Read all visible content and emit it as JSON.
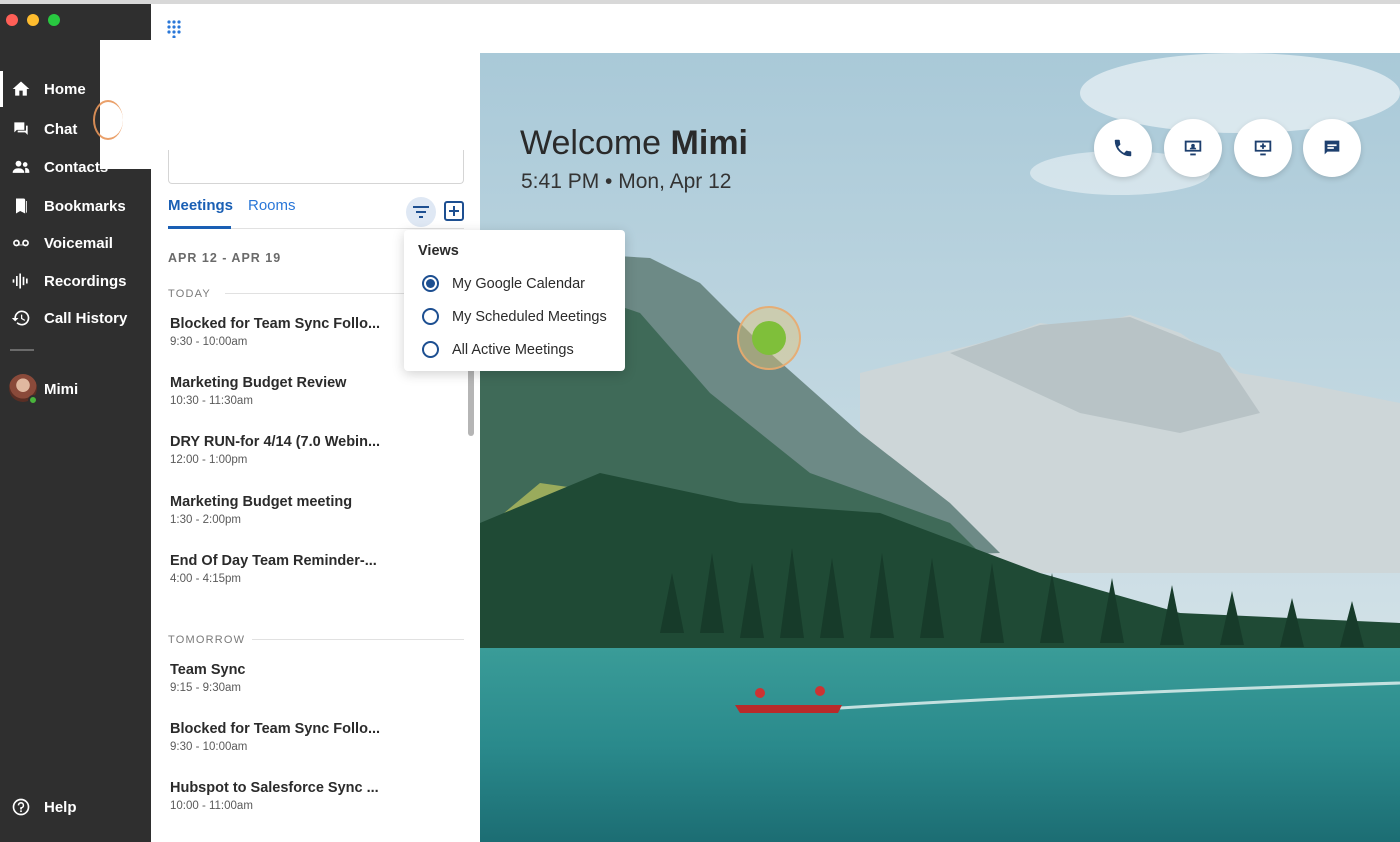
{
  "window": {
    "traffic_colors": [
      "#ff5f57",
      "#febc2e",
      "#28c840"
    ]
  },
  "sidebar": {
    "items": [
      {
        "label": "Home",
        "icon": "home-icon"
      },
      {
        "label": "Chat",
        "icon": "chat-icon"
      },
      {
        "label": "Contacts",
        "icon": "contacts-icon"
      },
      {
        "label": "Bookmarks",
        "icon": "bookmark-icon"
      },
      {
        "label": "Voicemail",
        "icon": "voicemail-icon"
      },
      {
        "label": "Recordings",
        "icon": "recordings-icon"
      },
      {
        "label": "Call History",
        "icon": "history-icon"
      }
    ],
    "user": {
      "name": "Mimi",
      "status_color": "#49b43c"
    },
    "help": "Help"
  },
  "meetings_panel": {
    "tabs": [
      "Meetings",
      "Rooms"
    ],
    "date_range": "APR 12 - APR 19",
    "today_label": "TODAY",
    "tomorrow_label": "TOMORROW",
    "today": [
      {
        "title": "Blocked for Team Sync Follo...",
        "time": "9:30 - 10:00am"
      },
      {
        "title": "Marketing Budget Review",
        "time": "10:30 - 11:30am"
      },
      {
        "title": "DRY RUN-for 4/14 (7.0 Webin...",
        "time": "12:00 - 1:00pm"
      },
      {
        "title": "Marketing Budget meeting",
        "time": "1:30 - 2:00pm"
      },
      {
        "title": "End Of Day Team Reminder-...",
        "time": "4:00 - 4:15pm"
      }
    ],
    "tomorrow": [
      {
        "title": "Team Sync",
        "time": "9:15 - 9:30am"
      },
      {
        "title": "Blocked for Team Sync Follo...",
        "time": "9:30 - 10:00am"
      },
      {
        "title": "Hubspot to Salesforce Sync ...",
        "time": "10:00 - 11:00am"
      }
    ]
  },
  "views_menu": {
    "title": "Views",
    "options": [
      {
        "label": "My Google Calendar",
        "selected": true
      },
      {
        "label": "My Scheduled Meetings",
        "selected": false
      },
      {
        "label": "All Active Meetings",
        "selected": false
      }
    ]
  },
  "hero": {
    "welcome_prefix": "Welcome",
    "user_name": "Mimi",
    "datetime": "5:41 PM • Mon, Apr 12",
    "actions": [
      "phone-icon",
      "screen-share-icon",
      "new-meeting-icon",
      "chat-bubble-icon"
    ]
  },
  "colors": {
    "accent": "#1a5fb4",
    "sidebar_bg": "#2f2f2f",
    "presence": "#49b43c"
  }
}
